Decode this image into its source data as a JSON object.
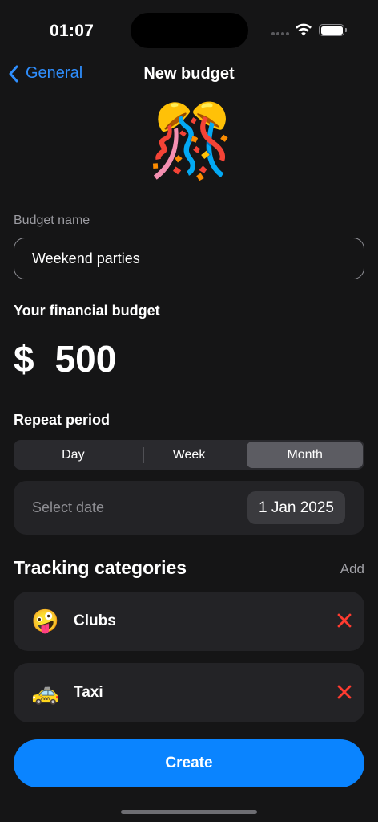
{
  "status": {
    "time": "01:07"
  },
  "nav": {
    "back_label": "General",
    "title": "New budget"
  },
  "hero": {
    "emoji": "🎊"
  },
  "budget_name": {
    "label": "Budget name",
    "value": "Weekend parties"
  },
  "financial": {
    "title": "Your financial budget",
    "currency": "$",
    "amount": "500"
  },
  "repeat": {
    "title": "Repeat period",
    "options": [
      "Day",
      "Week",
      "Month"
    ],
    "selected": "Month",
    "select_date_label": "Select date",
    "date_value": "1 Jan 2025"
  },
  "categories": {
    "title": "Tracking categories",
    "add_label": "Add",
    "items": [
      {
        "emoji": "🤪",
        "name": "Clubs"
      },
      {
        "emoji": "🚕",
        "name": "Taxi"
      }
    ]
  },
  "create_label": "Create",
  "colors": {
    "accent": "#0a84ff",
    "link": "#2f8fff",
    "remove": "#ff3b30",
    "background": "#151516",
    "card": "#232326"
  }
}
